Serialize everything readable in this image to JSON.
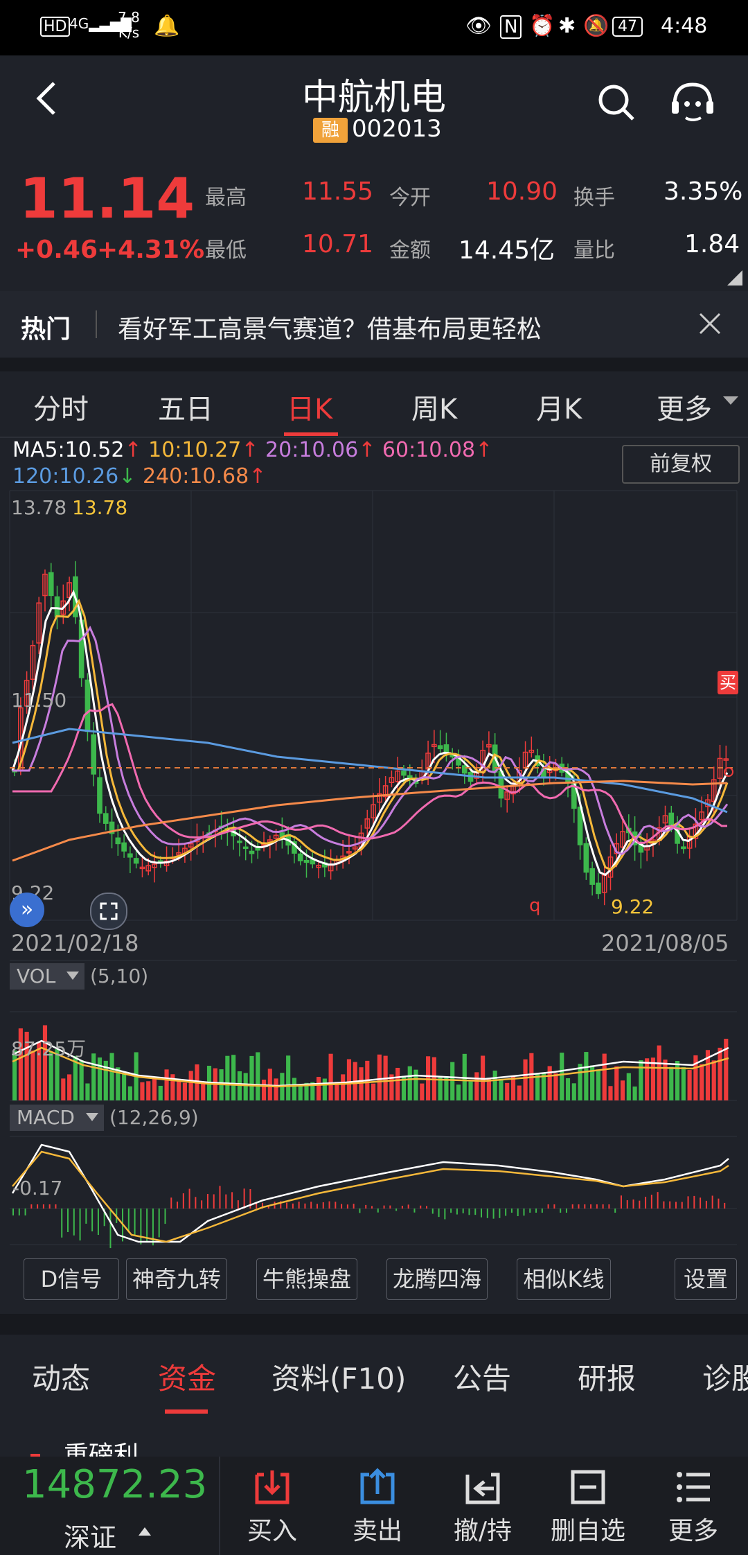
{
  "status_bar": {
    "left": "HD 4G",
    "speed": "7.8 K/s",
    "battery": "47",
    "time": "4:48"
  },
  "header": {
    "title": "中航机电",
    "rzrq_badge": "融",
    "code": "002013"
  },
  "quote": {
    "price": "11.14",
    "change": "+0.46",
    "change_pct": "+4.31%",
    "stats": [
      {
        "label": "最高",
        "value": "11.55"
      },
      {
        "label": "今开",
        "value": "10.90"
      },
      {
        "label": "换手",
        "value": "3.35%"
      },
      {
        "label": "最低",
        "value": "10.71"
      },
      {
        "label": "金额",
        "value": "14.45亿"
      },
      {
        "label": "量比",
        "value": "1.84"
      }
    ]
  },
  "hot": {
    "label": "热门",
    "text": "看好军工高景气赛道？借基布局更轻松"
  },
  "period_tabs": [
    "分时",
    "五日",
    "日K",
    "周K",
    "月K",
    "更多"
  ],
  "period_active": "日K",
  "ma_legend": {
    "line1": [
      {
        "text": "MA5:10.52",
        "color": "#ffffff",
        "arrow": "↑"
      },
      {
        "text": "10:10.27",
        "color": "#f5b83a",
        "arrow": "↑"
      },
      {
        "text": "20:10.06",
        "color": "#c77ddd",
        "arrow": "↑"
      },
      {
        "text": "60:10.08",
        "color": "#f06ab0",
        "arrow": "↑"
      }
    ],
    "line2": [
      {
        "text": "120:10.26",
        "color": "#5b9be0",
        "arrow": "↓"
      },
      {
        "text": "240:10.68",
        "color": "#f58a4a",
        "arrow": "↑"
      }
    ],
    "fq_button": "前复权"
  },
  "kline": {
    "max_label": "13.78",
    "max_tag": "13.78",
    "mid_label": "11.50",
    "min_label": "9.22",
    "min_tag": "9.22",
    "buy_marker": "买",
    "q_marker": "q",
    "date_start": "2021/02/18",
    "date_end": "2021/08/05"
  },
  "volume": {
    "label": "VOL",
    "params": "(5,10)",
    "scale_label": "87.25万"
  },
  "macd": {
    "label": "MACD",
    "params": "(12,26,9)",
    "scale_label": "-0.17"
  },
  "tools": [
    "D信号",
    "神奇九转",
    "牛熊操盘",
    "龙腾四海",
    "相似K线",
    "设置"
  ],
  "bottom_tabs": [
    "动态",
    "资金",
    "资料(F10)",
    "公告",
    "研报",
    "诊股"
  ],
  "bottom_active": "资金",
  "strip_text": "重磅利",
  "footer": {
    "index_value": "14872.23",
    "index_name": "深证",
    "buttons": [
      "买入",
      "卖出",
      "撤/持",
      "删自选",
      "更多"
    ]
  },
  "colors": {
    "up": "#ee3b3b",
    "down": "#3db84c",
    "bg": "#1f2229"
  }
}
